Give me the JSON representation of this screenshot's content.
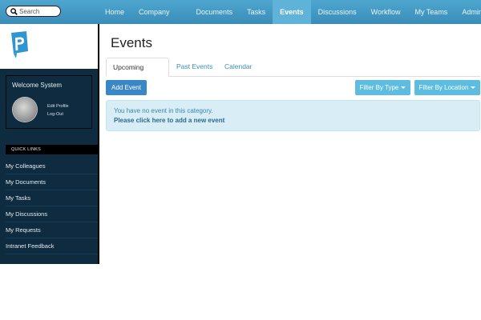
{
  "search": {
    "placeholder": "Search"
  },
  "nav": {
    "items": [
      {
        "label": "Home"
      },
      {
        "label": "Company"
      },
      {
        "label": "Documents"
      },
      {
        "label": "Tasks"
      },
      {
        "label": "Events",
        "active": true
      },
      {
        "label": "Discussions"
      },
      {
        "label": "Workflow"
      },
      {
        "label": "My Teams"
      },
      {
        "label": "Admin"
      }
    ]
  },
  "sidebar": {
    "welcome": "Welcome System",
    "edit_profile": "Edit Profile",
    "logout": "Log-Out",
    "quick_links_header": "QUICK LINKS",
    "quick_links": [
      {
        "label": "My Colleagues"
      },
      {
        "label": "My Documents"
      },
      {
        "label": "My Tasks"
      },
      {
        "label": "My Discussions"
      },
      {
        "label": "My Requests"
      },
      {
        "label": "Intranet Feedback"
      }
    ]
  },
  "main": {
    "title": "Events",
    "tabs": [
      {
        "label": "Upcoming Events",
        "active": true
      },
      {
        "label": "Past Events"
      },
      {
        "label": "Calendar"
      }
    ],
    "add_button": "Add Event",
    "filter_type": "Filter By Type",
    "filter_location": "Filter By Location",
    "alert_line1": "You have no event in this category.",
    "alert_line2": "Please click here to add a new event"
  },
  "colors": {
    "topbar": "#3a8db8",
    "sidebar": "#0f2b40",
    "primary_button": "#3a87c8",
    "info_button": "#5cbde0",
    "alert_bg": "#d9edf7"
  }
}
